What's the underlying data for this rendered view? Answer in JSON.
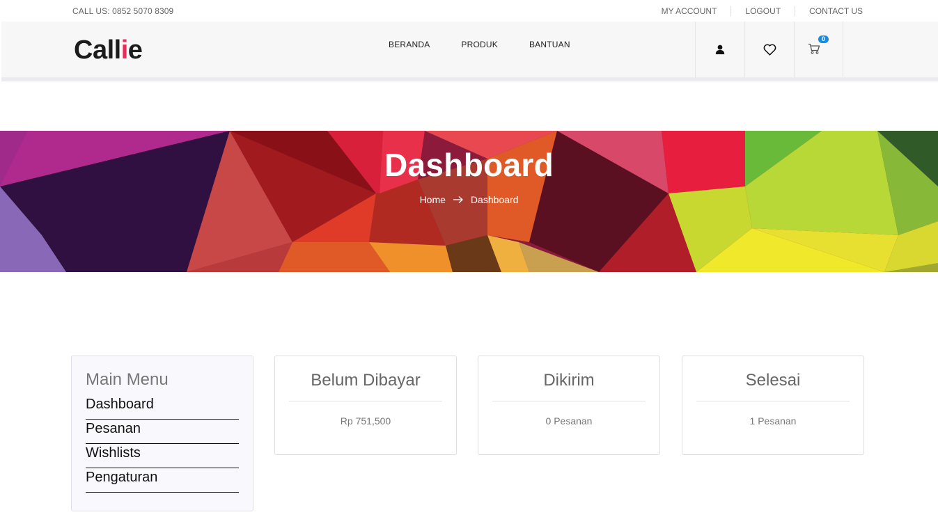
{
  "topbar": {
    "call": "CALL US: 0852 5070 8309",
    "links": [
      "MY ACCOUNT",
      "LOGOUT",
      "CONTACT US"
    ]
  },
  "header": {
    "logo_part1": "Call",
    "logo_accent": "i",
    "logo_part2": "e",
    "nav": [
      "BERANDA",
      "PRODUK",
      "BANTUAN"
    ],
    "icons": [
      "user-icon",
      "heart-icon",
      "cart-icon"
    ],
    "cart_count": "0"
  },
  "hero": {
    "title": "Dashboard",
    "breadcrumb": [
      "Home",
      "Dashboard"
    ]
  },
  "sidebar": {
    "title": "Main Menu",
    "items": [
      "Dashboard",
      "Pesanan",
      "Wishlists",
      "Pengaturan"
    ]
  },
  "cards": [
    {
      "title": "Belum Dibayar",
      "value": "Rp 751,500"
    },
    {
      "title": "Dikirim",
      "value": "0 Pesanan"
    },
    {
      "title": "Selesai",
      "value": "1 Pesanan"
    }
  ],
  "colors": {
    "accent": "#ee2a5a",
    "badge": "#1a8ce0"
  }
}
